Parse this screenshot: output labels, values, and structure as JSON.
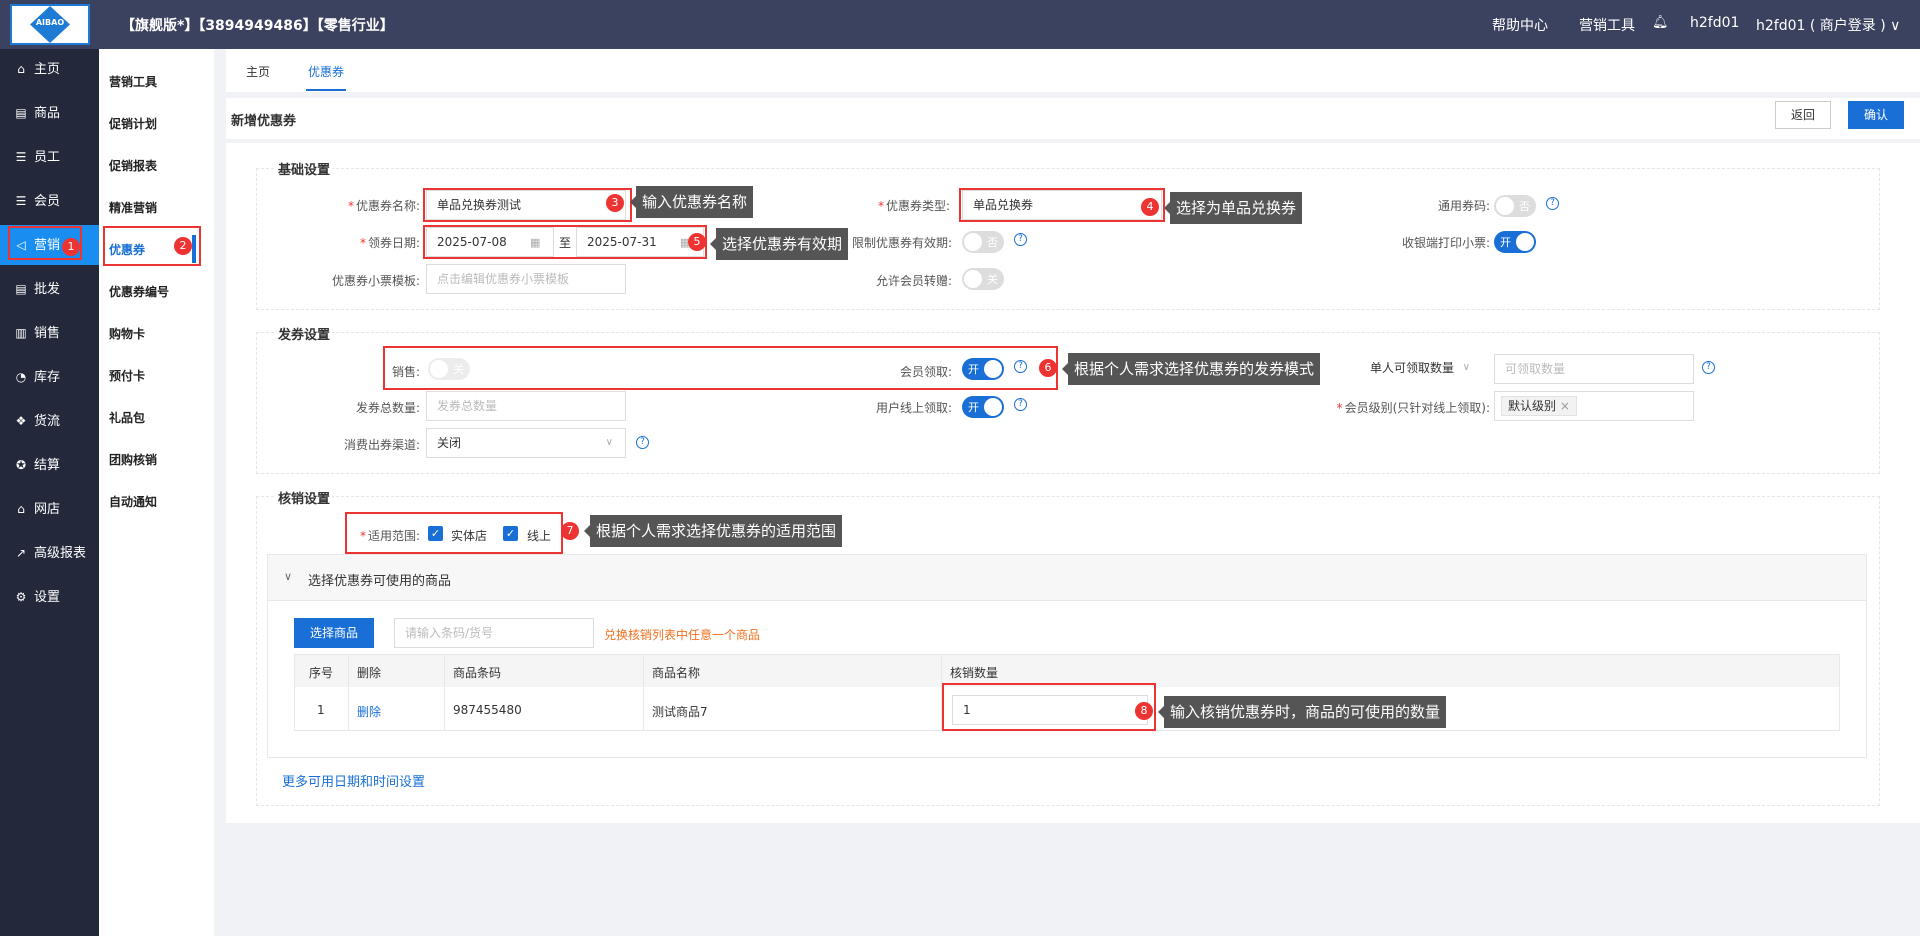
{
  "header": {
    "logo_text": "AIBAO",
    "info": "【旗舰版*】【3894949486】【零售行业】",
    "help": "帮助中心",
    "marketing_tools": "营销工具",
    "user_short": "h2fd01",
    "user_full": "h2fd01 ( 商户登录 ) ∨"
  },
  "sidebar": {
    "items": [
      {
        "label": "主页",
        "icon": "⌂"
      },
      {
        "label": "商品",
        "icon": "▤"
      },
      {
        "label": "员工",
        "icon": "☰"
      },
      {
        "label": "会员",
        "icon": "☰"
      },
      {
        "label": "营销",
        "icon": "◁"
      },
      {
        "label": "批发",
        "icon": "▤"
      },
      {
        "label": "销售",
        "icon": "▥"
      },
      {
        "label": "库存",
        "icon": "◔"
      },
      {
        "label": "货流",
        "icon": "❖"
      },
      {
        "label": "结算",
        "icon": "✪"
      },
      {
        "label": "网店",
        "icon": "⌂"
      },
      {
        "label": "高级报表",
        "icon": "↗"
      },
      {
        "label": "设置",
        "icon": "⚙"
      }
    ]
  },
  "subside": {
    "items": [
      "营销工具",
      "促销计划",
      "促销报表",
      "精准营销",
      "优惠券",
      "优惠券编号",
      "购物卡",
      "预付卡",
      "礼品包",
      "团购核销",
      "自动通知"
    ]
  },
  "tabs": [
    "主页",
    "优惠券"
  ],
  "page": {
    "title": "新增优惠券",
    "back": "返回",
    "confirm": "确认"
  },
  "basic": {
    "title": "基础设置",
    "name_label": "优惠券名称:",
    "name_value": "单品兑换券测试",
    "type_label": "优惠券类型:",
    "type_value": "单品兑换券",
    "general_label": "通用券码:",
    "general_state": "否",
    "date_label": "领券日期:",
    "date_start": "2025-07-08",
    "date_sep": "至",
    "date_end": "2025-07-31",
    "limit_label": "限制优惠券有效期:",
    "limit_state": "否",
    "print_label": "收银端打印小票:",
    "print_state": "开",
    "ticket_label": "优惠券小票模板:",
    "ticket_placeholder": "点击编辑优惠券小票模板",
    "transfer_label": "允许会员转赠:",
    "transfer_state": "关"
  },
  "issue": {
    "title": "发券设置",
    "sale_label": "销售:",
    "sale_state": "关",
    "member_label": "会员领取:",
    "member_state": "开",
    "per_select": "单人可领取数量",
    "per_placeholder": "可领取数量",
    "total_label": "发券总数量:",
    "total_placeholder": "发券总数量",
    "online_label": "用户线上领取:",
    "online_state": "开",
    "level_label": "会员级别(只针对线上领取):",
    "level_tag": "默认级别",
    "channel_label": "消费出券渠道:",
    "channel_value": "关闭"
  },
  "verify": {
    "title": "核销设置",
    "scope_label": "适用范围:",
    "scope_store": "实体店",
    "scope_online": "线上",
    "collapse_title": "选择优惠券可使用的商品",
    "select_btn": "选择商品",
    "barcode_placeholder": "请输入条码/货号",
    "hint": "兑换核销列表中任意一个商品",
    "columns": [
      "序号",
      "删除",
      "商品条码",
      "商品名称",
      "核销数量"
    ],
    "row": {
      "index": "1",
      "delete": "删除",
      "barcode": "987455480",
      "name": "测试商品7",
      "qty": "1"
    },
    "more": "更多可用日期和时间设置"
  },
  "annotations": {
    "n1": "1",
    "n2": "2",
    "n3": "3",
    "n4": "4",
    "n5": "5",
    "n6": "6",
    "n7": "7",
    "n8": "8",
    "c3": "输入优惠券名称",
    "c4": "选择为单品兑换券",
    "c5": "选择优惠券有效期",
    "c6": "根据个人需求选择优惠券的发券模式",
    "c7": "根据个人需求选择优惠券的适用范围",
    "c8": "输入核销优惠券时，商品的可使用的数量"
  },
  "colors": {
    "topbar": "#3b4260",
    "sidebar": "#23293b",
    "accent": "#1a6fd6",
    "annotation": "#e33333",
    "callout": "#555555"
  }
}
